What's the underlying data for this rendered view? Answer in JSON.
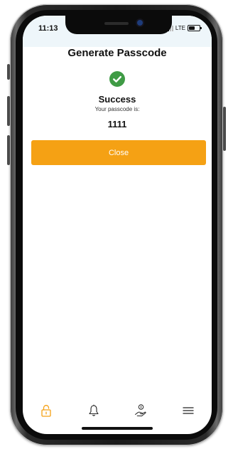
{
  "status_bar": {
    "time": "11:13",
    "network": "LTE",
    "battery_level": 0.7
  },
  "screen": {
    "title": "Generate Passcode",
    "success_title": "Success",
    "passcode_label": "Your passcode is:",
    "passcode": "1111",
    "close_label": "Close"
  },
  "colors": {
    "accent": "#f5a114",
    "success": "#3f9b45",
    "status_bar_bg": "#eef6fa"
  },
  "tab_bar": {
    "items": [
      {
        "icon": "lock-icon",
        "active": true
      },
      {
        "icon": "bell-icon",
        "active": false
      },
      {
        "icon": "hand-coin-icon",
        "active": false
      },
      {
        "icon": "menu-icon",
        "active": false
      }
    ]
  }
}
